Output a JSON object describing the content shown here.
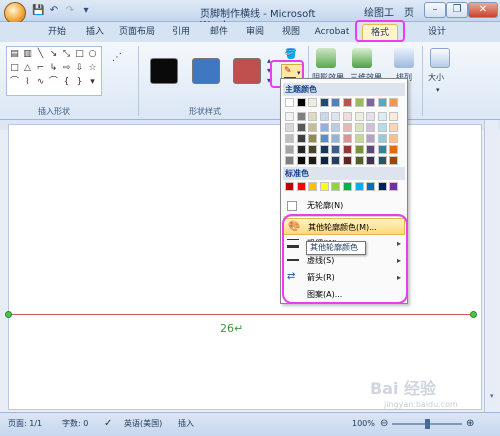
{
  "window": {
    "title": "页脚制作横线 - Microsoft Word",
    "context_tool": "绘图工具",
    "context_overflow": "页",
    "quick_access": [
      "💾",
      "↶",
      "↷",
      "▾"
    ]
  },
  "tabs": [
    "开始",
    "插入",
    "页面布局",
    "引用",
    "邮件",
    "审阅",
    "视图",
    "Acrobat",
    "格式",
    "设计"
  ],
  "active_tab": "格式",
  "ribbon": {
    "groups": [
      "插入形状",
      "形状样式"
    ],
    "shape_styles_colors": [
      "#0a0a0a",
      "#3f78c0",
      "#c0504d"
    ],
    "buttons": {
      "shadow_effect": "阴影效果",
      "3d_effect": "三维效果",
      "arrange": "排列",
      "size": "大小"
    }
  },
  "dropdown": {
    "theme_colors_label": "主题颜色",
    "standard_colors_label": "标准色",
    "theme_top_row": [
      "#ffffff",
      "#000000",
      "#eeece1",
      "#1f497d",
      "#4f81bd",
      "#c0504d",
      "#9bbb59",
      "#8064a2",
      "#4bacc6",
      "#f79646"
    ],
    "theme_shades": [
      [
        "#f2f2f2",
        "#7f7f7f",
        "#ddd9c3",
        "#c6d9f0",
        "#dbe5f1",
        "#f2dcdb",
        "#ebf1dd",
        "#e5e0ec",
        "#dbeef3",
        "#fdeada"
      ],
      [
        "#d8d8d8",
        "#595959",
        "#c4bd97",
        "#8db3e2",
        "#b8cce4",
        "#e5b9b7",
        "#d7e3bc",
        "#ccc1d9",
        "#b7dde8",
        "#fbd5b5"
      ],
      [
        "#bfbfbf",
        "#3f3f3f",
        "#938953",
        "#548dd4",
        "#95b3d7",
        "#d99694",
        "#c3d69b",
        "#b2a2c7",
        "#92cddc",
        "#fac08f"
      ],
      [
        "#a5a5a5",
        "#262626",
        "#494429",
        "#17365d",
        "#366092",
        "#953734",
        "#76923c",
        "#5f497a",
        "#31859b",
        "#e36c09"
      ],
      [
        "#7f7f7f",
        "#0c0c0c",
        "#1d1b10",
        "#0f243e",
        "#244061",
        "#632423",
        "#4f6128",
        "#3f3151",
        "#205867",
        "#974806"
      ]
    ],
    "standard_colors": [
      "#c00000",
      "#ff0000",
      "#ffc000",
      "#ffff00",
      "#92d050",
      "#00b050",
      "#00b0f0",
      "#0070c0",
      "#002060",
      "#7030a0"
    ],
    "no_outline": "无轮廓(N)",
    "more_colors": "其他轮廓颜色(M)...",
    "weight": "粗细(W)",
    "dashes": "虚线(S)",
    "arrows": "箭头(R)",
    "pattern": "图案(A)...",
    "tooltip": "其他轮廓颜色"
  },
  "document": {
    "page_number": "26↵"
  },
  "status": {
    "page": "页面: 1/1",
    "words": "字数: 0",
    "lang": "英语(美国)",
    "mode": "插入",
    "zoom": "100%"
  },
  "watermark": {
    "brand": "Bai 经验",
    "url": "jingyan.baidu.com"
  }
}
